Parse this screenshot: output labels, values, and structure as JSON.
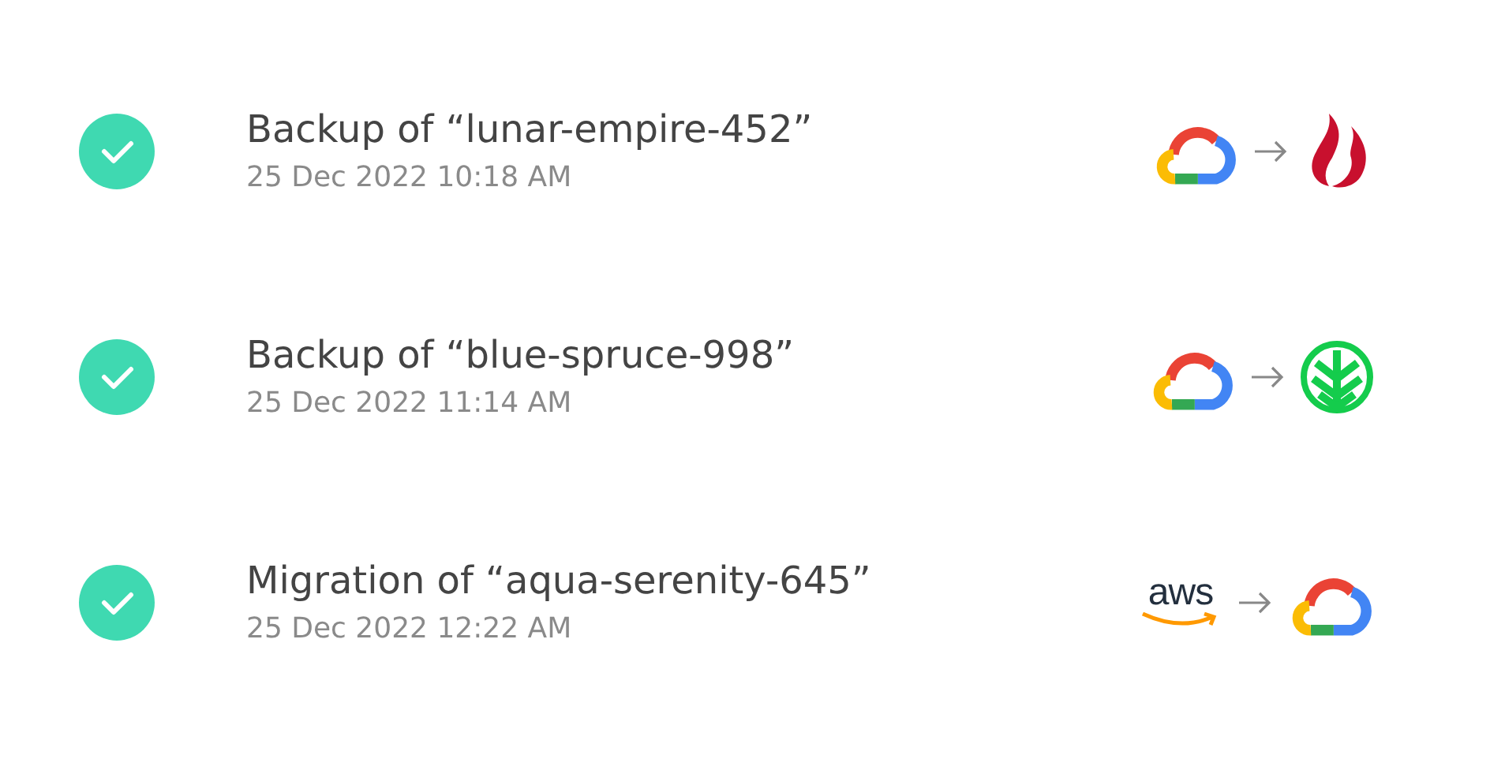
{
  "jobs": [
    {
      "title": "Backup of “lunar-empire-452”",
      "timestamp": "25 Dec 2022 10:18 AM",
      "done": true,
      "source": {
        "kind": "cloud"
      },
      "target": {
        "kind": "flame"
      }
    },
    {
      "title": "Backup of “blue-spruce-998”",
      "timestamp": "25 Dec 2022 11:14 AM",
      "done": true,
      "source": {
        "kind": "cloud"
      },
      "target": {
        "kind": "tree"
      }
    },
    {
      "title": "Migration of “aqua-serenity-645”",
      "timestamp": "25 Dec 2022 12:22 AM",
      "done": true,
      "source": {
        "kind": "wordmark",
        "text": "aws"
      },
      "target": {
        "kind": "cloud"
      }
    }
  ]
}
